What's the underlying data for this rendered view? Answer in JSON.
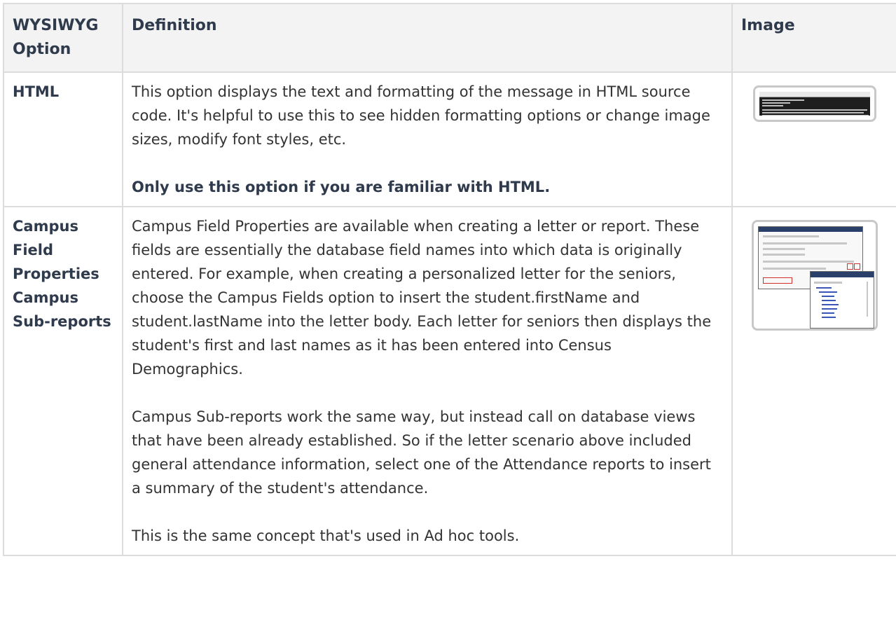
{
  "table": {
    "headers": {
      "option": "WYSIWYG Option",
      "definition": "Definition",
      "image": "Image"
    },
    "rows": [
      {
        "option": "HTML",
        "paragraphs": [
          "This option displays the text and formatting of the message in HTML source code. It's helpful to use this to see hidden formatting options or change image sizes, modify font styles, etc."
        ],
        "note": "Only use this option if you are familiar with HTML."
      },
      {
        "option": "Campus Field Properties Campus Sub-reports",
        "paragraphs": [
          "Campus Field Properties are available when creating a letter or report. These fields are essentially the database field names into which data is originally entered. For example, when creating a personalized letter for the seniors, choose the Campus Fields option to insert the student.firstName and student.lastName into the letter body. Each letter for seniors then displays the student's first and last names as it has been entered into Census Demographics.",
          "Campus Sub-reports work the same way, but instead call on database views that have been already established. So if the letter scenario above included general attendance information, select one of the Attendance reports to insert a summary of the student's attendance.",
          "This is the same concept that's used in Ad hoc tools."
        ]
      }
    ]
  },
  "colors": {
    "header_bg": "#f3f3f3",
    "border": "#dcdcdc",
    "text": "#333333",
    "heading_text": "#2f3b4c"
  }
}
